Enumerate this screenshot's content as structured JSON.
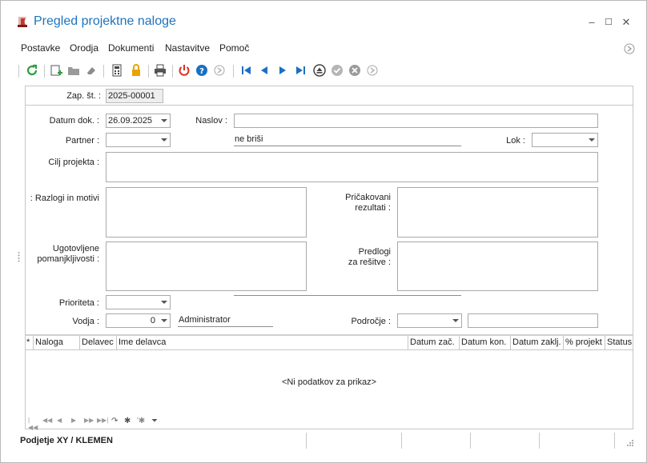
{
  "window": {
    "title": "Pregled projektne naloge"
  },
  "window_controls": {
    "minimize": "–",
    "maximize": "☐",
    "close": "✕"
  },
  "menu": {
    "items": [
      "Postavke",
      "Orodja",
      "Dokumenti",
      "Nastavitve",
      "Pomoč"
    ]
  },
  "form": {
    "zap_st": {
      "label": "Zap. št. :",
      "value": "2025-00001"
    },
    "datum_dok": {
      "label": "Datum dok. :",
      "value": "26.09.2025"
    },
    "naslov": {
      "label": "Naslov :",
      "value": ""
    },
    "partner": {
      "label": "Partner :",
      "value": "",
      "name": "ne briši"
    },
    "lok": {
      "label": "Lok :",
      "value": ""
    },
    "cilj_projekta": {
      "label": "Cilj projekta :"
    },
    "razlogi": {
      "label": "Razlogi in motivi :"
    },
    "pricakovani": {
      "label_line1": "Pričakovani",
      "label_line2": "rezultati :"
    },
    "ugotovljene": {
      "label_line1": "Ugotovljene",
      "label_line2": "pomanjkljivosti :"
    },
    "predlogi": {
      "label_line1": "Predlogi",
      "label_line2": "za rešitve :"
    },
    "prioriteta": {
      "label": "Prioriteta :",
      "value": ""
    },
    "vodja": {
      "label": "Vodja :",
      "value": "0",
      "name": "Administrator"
    },
    "podrocje": {
      "label": "Področje :",
      "value": "",
      "text": ""
    }
  },
  "grid": {
    "columns": [
      "*",
      "Naloga",
      "Delavec",
      "Ime delavca",
      "Datum zač.",
      "Datum kon.",
      "Datum zaklj.",
      "% projekt",
      "Status"
    ],
    "empty_text": "<Ni podatkov za prikaz>"
  },
  "statusbar": {
    "text": "Podjetje  XY / KLEMEN"
  },
  "colors": {
    "title": "#1e73be",
    "accent_blue": "#1a6fc4",
    "refresh_green": "#2e9e3e",
    "power_red": "#d9301f",
    "lock_yellow": "#e8a400"
  }
}
